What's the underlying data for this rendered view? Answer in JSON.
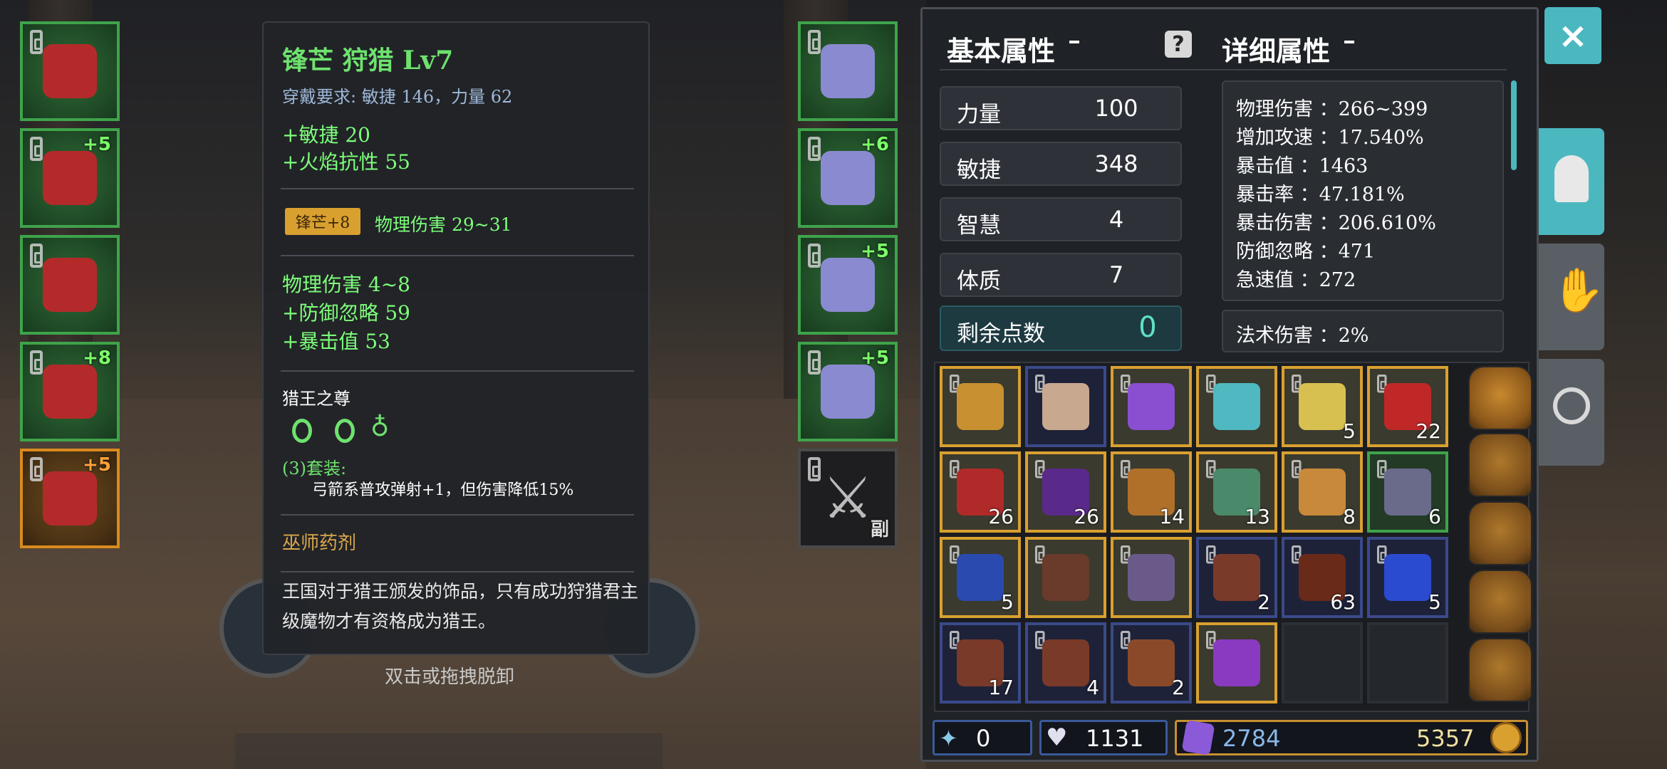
{
  "tooltip": {
    "title": "锋芒 狩猎 Lv7",
    "requirement": "穿戴要求:   敏捷 146，力量 62",
    "stats_a": [
      "+敏捷 20",
      "+火焰抗性 55"
    ],
    "badge": "锋芒+8",
    "badge_stat": "物理伤害 29~31",
    "stats_b": [
      "物理伤害 4~8",
      "+防御忽略 59",
      "+暴击值 53"
    ],
    "set_name": "猎王之尊",
    "set_bonus_title": "(3)套装:",
    "set_bonus_desc": "弓箭系普攻弹射+1，但伤害降低15%",
    "class_label": "巫师药剂",
    "description": "王国对于猎王颁发的饰品，只有成功狩猎君主级魔物才有资格成为猎王。"
  },
  "hint": "双击或拖拽脱卸",
  "left_slots": [
    {
      "name": "helmet-slot",
      "plus": ""
    },
    {
      "name": "armor-slot",
      "plus": "+5"
    },
    {
      "name": "pants-slot",
      "plus": ""
    },
    {
      "name": "ring-slot",
      "plus": "+8"
    },
    {
      "name": "bow-slot",
      "plus": "+5"
    }
  ],
  "right_slots": [
    {
      "name": "amulet-slot",
      "plus": ""
    },
    {
      "name": "gloves-slot",
      "plus": "+6"
    },
    {
      "name": "boots-slot",
      "plus": "+5"
    },
    {
      "name": "ring2-slot",
      "plus": "+5"
    },
    {
      "name": "offhand-slot",
      "plus": "副"
    }
  ],
  "panel": {
    "basic_title": "基本属性",
    "detail_title": "详细属性",
    "attrs": [
      {
        "label": "力量",
        "value": "100"
      },
      {
        "label": "敏捷",
        "value": "348"
      },
      {
        "label": "智慧",
        "value": "4"
      },
      {
        "label": "体质",
        "value": "7"
      }
    ],
    "remaining_label": "剩余点数",
    "remaining_value": "0",
    "details": [
      "物理伤害 ：266~399",
      "增加攻速 ：17.540%",
      "暴击值 ：1463",
      "暴击率 ：47.181%",
      "暴击伤害 ：206.610%",
      "防御忽略 ：471",
      "急速值 ：272"
    ],
    "magic_damage": "法术伤害 ：2%"
  },
  "inventory": [
    {
      "c": "gold",
      "n": "",
      "color": "#c89030"
    },
    {
      "c": "blue",
      "n": "",
      "color": "#c9a890"
    },
    {
      "c": "gold",
      "n": "",
      "color": "#8a4fd0"
    },
    {
      "c": "gold",
      "n": "",
      "color": "#4fb8c0"
    },
    {
      "c": "gold",
      "n": "5",
      "color": "#d8c050"
    },
    {
      "c": "gold",
      "n": "22",
      "color": "#c02828"
    },
    {
      "c": "gold",
      "n": "26",
      "color": "#b02a2a"
    },
    {
      "c": "gold",
      "n": "26",
      "color": "#5a2a8a"
    },
    {
      "c": "gold",
      "n": "14",
      "color": "#b0702a"
    },
    {
      "c": "gold",
      "n": "13",
      "color": "#4a8a6a"
    },
    {
      "c": "gold",
      "n": "8",
      "color": "#c88a3a"
    },
    {
      "c": "green",
      "n": "6",
      "color": "#6a6a8a"
    },
    {
      "c": "gold",
      "n": "5",
      "color": "#2a4ab0"
    },
    {
      "c": "gold",
      "n": "",
      "color": "#6a3a2a"
    },
    {
      "c": "gold",
      "n": "",
      "color": "#6a5a8a"
    },
    {
      "c": "blue",
      "n": "2",
      "color": "#7a3a2a"
    },
    {
      "c": "blue",
      "n": "63",
      "color": "#6a2a1a"
    },
    {
      "c": "blue",
      "n": "5",
      "color": "#2a4ad0"
    },
    {
      "c": "blue",
      "n": "17",
      "color": "#7a3a2a"
    },
    {
      "c": "blue",
      "n": "4",
      "color": "#7a3a2a"
    },
    {
      "c": "blue",
      "n": "2",
      "color": "#8a4a2a"
    },
    {
      "c": "gold",
      "n": "",
      "color": "#8a3ac0"
    },
    {
      "c": "empty",
      "n": "",
      "color": ""
    },
    {
      "c": "empty",
      "n": "",
      "color": ""
    }
  ],
  "currency": {
    "tool": "0",
    "hearts": "1131",
    "gems": "2784",
    "coins": "5357"
  },
  "tabs": [
    "helmet-tab",
    "gloves-tab",
    "target-tab"
  ],
  "close_label": "×"
}
